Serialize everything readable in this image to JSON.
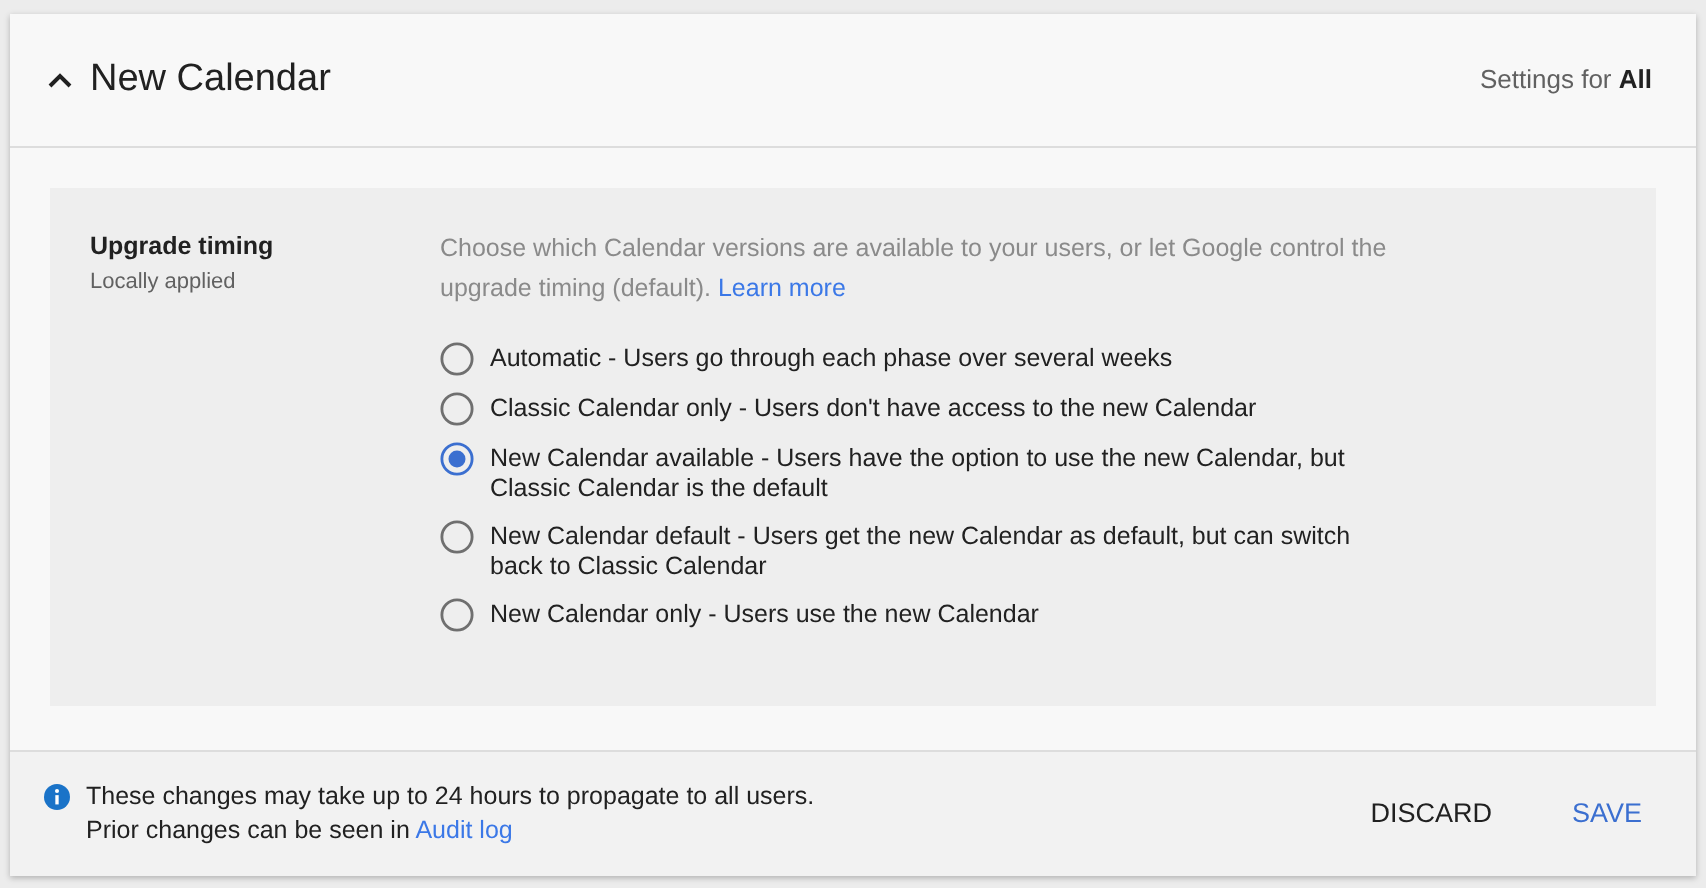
{
  "header": {
    "title": "New Calendar",
    "expanded": true,
    "scope_label": "Settings for",
    "scope_value": "All"
  },
  "setting": {
    "title": "Upgrade timing",
    "subtitle": "Locally applied",
    "description": "Choose which Calendar versions are available to your users, or let Google control the upgrade timing (default).",
    "link": "Learn more",
    "options": [
      {
        "label": "Automatic - Users go through each phase over several weeks",
        "selected": false
      },
      {
        "label": "Classic Calendar only - Users don't have access to the new Calendar",
        "selected": false
      },
      {
        "label": "New Calendar available - Users have the option to use the new Calendar, but Classic Calendar is the default",
        "selected": true
      },
      {
        "label": "New Calendar default - Users get the new Calendar as default, but can switch back to Classic Calendar",
        "selected": false
      },
      {
        "label": "New Calendar only - Users use the new Calendar",
        "selected": false
      }
    ]
  },
  "footer": {
    "note": "These changes may take up to 24 hours to propagate to all users.",
    "prior": "Prior changes can be seen in",
    "link": "Audit log",
    "buttons": [
      "DISCARD",
      "SAVE"
    ]
  }
}
